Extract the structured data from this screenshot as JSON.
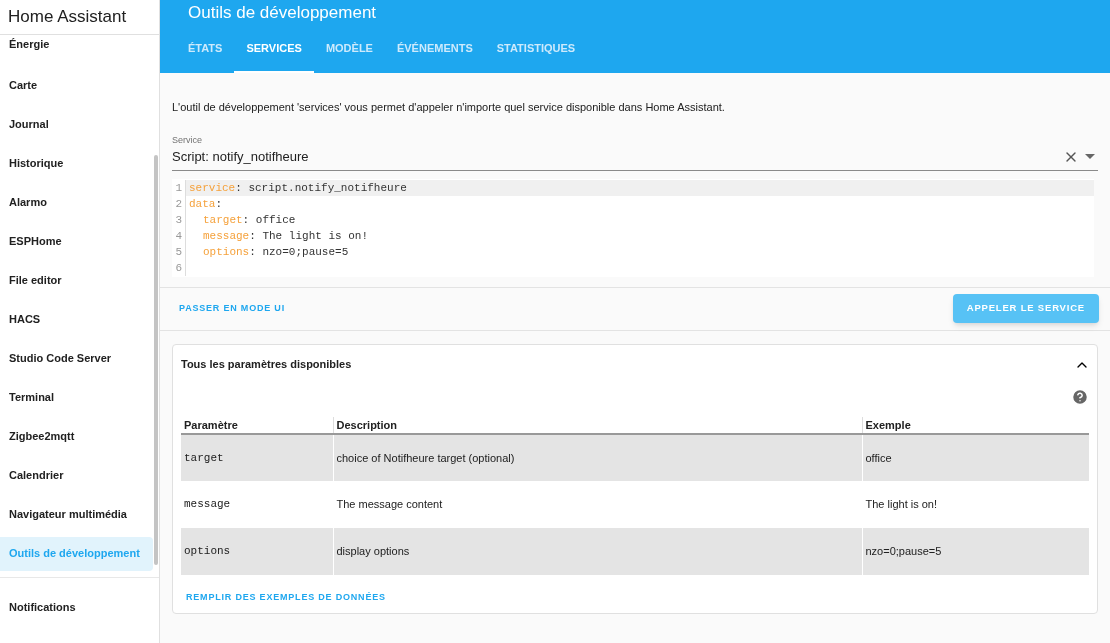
{
  "sidebar": {
    "title": "Home Assistant",
    "items": [
      {
        "label": "Énergie",
        "selected": false
      },
      {
        "label": "Carte",
        "selected": false
      },
      {
        "label": "Journal",
        "selected": false
      },
      {
        "label": "Historique",
        "selected": false
      },
      {
        "label": "Alarmo",
        "selected": false
      },
      {
        "label": "ESPHome",
        "selected": false
      },
      {
        "label": "File editor",
        "selected": false
      },
      {
        "label": "HACS",
        "selected": false
      },
      {
        "label": "Studio Code Server",
        "selected": false
      },
      {
        "label": "Terminal",
        "selected": false
      },
      {
        "label": "Zigbee2mqtt",
        "selected": false
      },
      {
        "label": "Calendrier",
        "selected": false
      },
      {
        "label": "Navigateur multimédia",
        "selected": false
      },
      {
        "label": "Outils de développement",
        "selected": true
      }
    ],
    "bottom_items": [
      {
        "label": "Notifications"
      }
    ]
  },
  "header": {
    "title": "Outils de développement",
    "tabs": [
      {
        "label": "ÉTATS",
        "selected": false
      },
      {
        "label": "SERVICES",
        "selected": true
      },
      {
        "label": "MODÈLE",
        "selected": false
      },
      {
        "label": "ÉVÉNEMENTS",
        "selected": false
      },
      {
        "label": "STATISTIQUES",
        "selected": false
      }
    ]
  },
  "intro": "L'outil de développement 'services' vous permet d'appeler n'importe quel service disponible dans Home Assistant.",
  "service_field": {
    "label": "Service",
    "value": "Script: notify_notifheure"
  },
  "code": [
    {
      "number": "1",
      "key": "service",
      "value": ": script.notify_notifheure"
    },
    {
      "number": "2",
      "key": "data",
      "value": ":",
      "children": [
        {
          "number": "3",
          "key": "target",
          "value": ": office"
        },
        {
          "number": "4",
          "key": "message",
          "value": ": The light is on!"
        },
        {
          "number": "5",
          "key": "options",
          "value": ": nzo=0;pause=5"
        }
      ]
    },
    {
      "number": "6"
    }
  ],
  "ui_mode_link": "PASSER EN MODE UI",
  "call_button": "APPELER LE SERVICE",
  "parameters": {
    "title": "Tous les paramètres disponibles",
    "expanded": true,
    "columns": [
      "Paramètre",
      "Description",
      "Exemple"
    ],
    "rows": [
      [
        "target",
        "choice of Notifheure target (optional)",
        "office"
      ],
      [
        "message",
        "The message content",
        "The light is on!"
      ],
      [
        "options",
        "display options",
        "nzo=0;pause=5"
      ]
    ],
    "fill_link": "REMPLIR DES EXEMPLES DE DONNÉES"
  }
}
